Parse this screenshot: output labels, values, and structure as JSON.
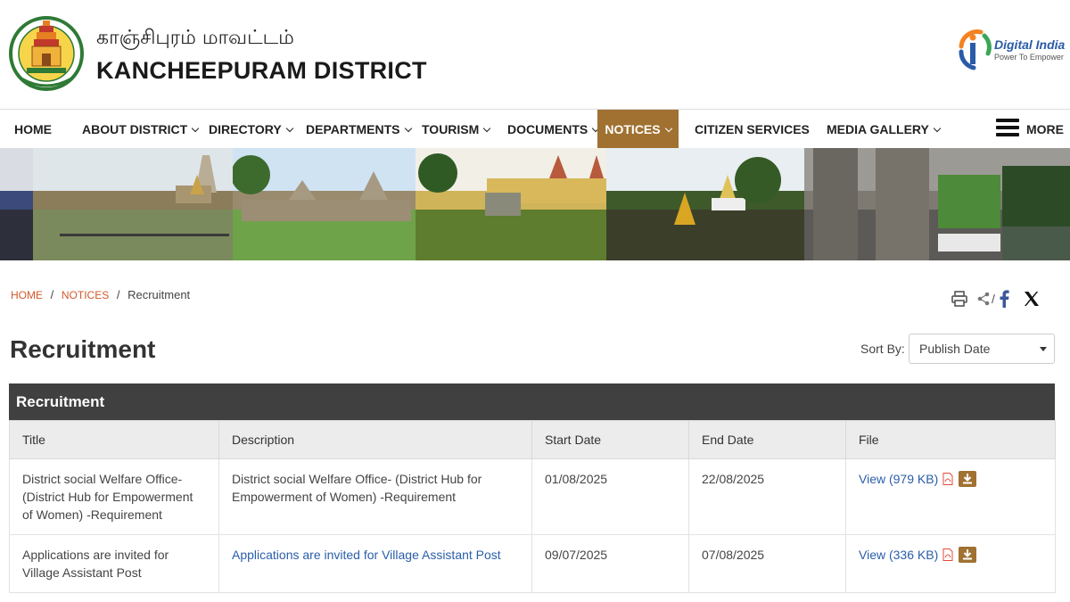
{
  "header": {
    "title_tamil": "காஞ்சிபுரம் மாவட்டம்",
    "title_english": "KANCHEEPURAM DISTRICT",
    "digital_india": {
      "title": "Digital India",
      "tagline": "Power To Empower"
    }
  },
  "nav": {
    "items": [
      {
        "label": "HOME",
        "dropdown": false
      },
      {
        "label": "ABOUT DISTRICT",
        "dropdown": true
      },
      {
        "label": "DIRECTORY",
        "dropdown": true
      },
      {
        "label": "DEPARTMENTS",
        "dropdown": true
      },
      {
        "label": "TOURISM",
        "dropdown": true
      },
      {
        "label": "DOCUMENTS",
        "dropdown": true
      },
      {
        "label": "NOTICES",
        "dropdown": true,
        "active": true
      },
      {
        "label": "CITIZEN SERVICES",
        "dropdown": false
      },
      {
        "label": "MEDIA GALLERY",
        "dropdown": true
      }
    ],
    "more_label": "MORE",
    "active_color": "#a07131"
  },
  "breadcrumb": {
    "home": "HOME",
    "notices": "NOTICES",
    "current": "Recruitment",
    "separator": "/"
  },
  "share": {
    "separator": "/"
  },
  "page": {
    "title": "Recruitment",
    "sort_label": "Sort By:",
    "sort_value": "Publish Date"
  },
  "table": {
    "caption": "Recruitment",
    "headers": [
      "Title",
      "Description",
      "Start Date",
      "End Date",
      "File"
    ],
    "rows": [
      {
        "title": "District social Welfare Office- (District Hub for Empowerment of Women) -Requirement",
        "description": "District social Welfare Office- (District Hub for Empowerment of Women) -Requirement",
        "start_date": "01/08/2025",
        "end_date": "22/08/2025",
        "file_label": "View (979 KB)"
      },
      {
        "title": "Applications are invited for Village Assistant Post",
        "description": "Applications are invited for Village Assistant Post",
        "start_date": "09/07/2025",
        "end_date": "07/08/2025",
        "file_label": "View (336 KB)"
      }
    ]
  },
  "colors": {
    "accent": "#a07131",
    "link": "#2a5ea8",
    "breadcrumb_link": "#d35a2a",
    "table_caption_bg": "#404040"
  }
}
